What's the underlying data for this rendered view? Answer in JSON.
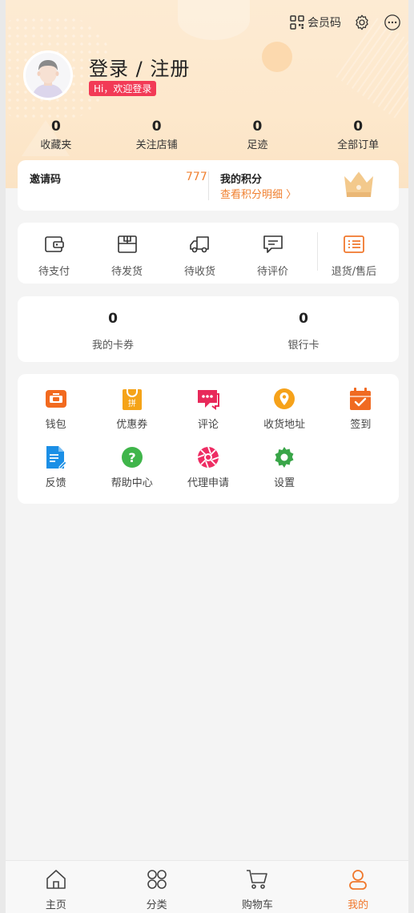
{
  "header": {
    "member_code_label": "会员码",
    "login_title": "登录 / 注册",
    "hi_badge": "Hi，欢迎登录"
  },
  "stats": [
    {
      "value": "0",
      "label": "收藏夹"
    },
    {
      "value": "0",
      "label": "关注店铺"
    },
    {
      "value": "0",
      "label": "足迹"
    },
    {
      "value": "0",
      "label": "全部订单"
    }
  ],
  "invite": {
    "label": "邀请码",
    "code": "777",
    "points_title": "我的积分",
    "points_link": "查看积分明细 〉"
  },
  "orders": [
    {
      "label": "待支付",
      "icon": "wallet-icon"
    },
    {
      "label": "待发货",
      "icon": "package-icon"
    },
    {
      "label": "待收货",
      "icon": "truck-icon"
    },
    {
      "label": "待评价",
      "icon": "comment-icon"
    },
    {
      "label": "退货/售后",
      "icon": "list-icon"
    }
  ],
  "wallet": [
    {
      "value": "0",
      "label": "我的卡券"
    },
    {
      "value": "0",
      "label": "银行卡"
    }
  ],
  "tools": [
    {
      "label": "钱包",
      "icon": "wallet-icon",
      "color": "#f26a1f"
    },
    {
      "label": "优惠券",
      "icon": "coupon-bag-icon",
      "color": "#f5a318"
    },
    {
      "label": "评论",
      "icon": "chat-icon",
      "color": "#e8295a"
    },
    {
      "label": "收货地址",
      "icon": "location-icon",
      "color": "#f6a21a"
    },
    {
      "label": "签到",
      "icon": "calendar-check-icon",
      "color": "#f06a22"
    },
    {
      "label": "反馈",
      "icon": "document-edit-icon",
      "color": "#1b8fe6"
    },
    {
      "label": "帮助中心",
      "icon": "help-icon",
      "color": "#3fb54a"
    },
    {
      "label": "代理申请",
      "icon": "aperture-icon",
      "color": "#ee2d64"
    },
    {
      "label": "设置",
      "icon": "gear-icon",
      "color": "#39a548"
    }
  ],
  "tabbar": [
    {
      "label": "主页",
      "icon": "home-icon"
    },
    {
      "label": "分类",
      "icon": "grid-icon"
    },
    {
      "label": "购物车",
      "icon": "cart-icon"
    },
    {
      "label": "我的",
      "icon": "user-icon",
      "active": true
    }
  ],
  "colors": {
    "accent": "#f0782d",
    "badge": "#f23a56",
    "hero_bg": "#fdebd3"
  }
}
